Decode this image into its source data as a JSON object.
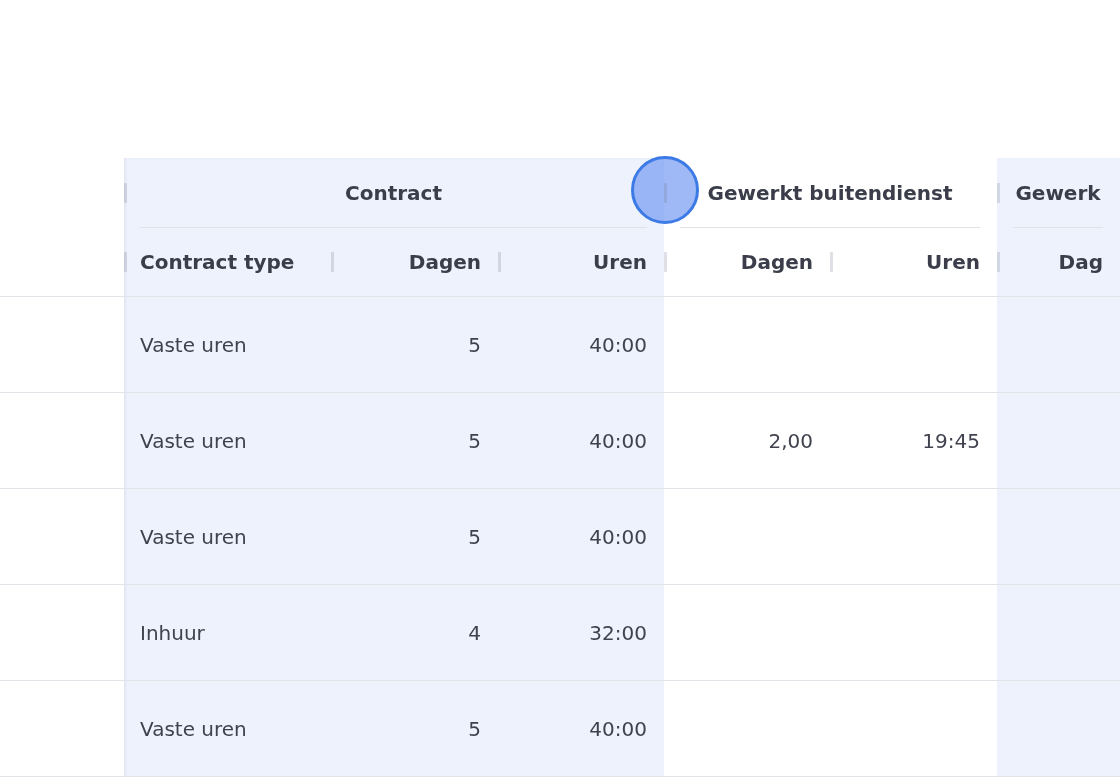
{
  "table": {
    "groups": [
      {
        "title": "Contract",
        "highlighted": true,
        "columns": [
          {
            "label": "Contract type",
            "kind": "text"
          },
          {
            "label": "Dagen",
            "kind": "number"
          },
          {
            "label": "Uren",
            "kind": "number"
          }
        ]
      },
      {
        "title": "Gewerkt buitendienst",
        "highlighted": false,
        "columns": [
          {
            "label": "Dagen",
            "kind": "number"
          },
          {
            "label": "Uren",
            "kind": "number"
          }
        ]
      },
      {
        "title": "Gewerk",
        "highlighted": true,
        "columns": [
          {
            "label": "Dag",
            "kind": "number"
          }
        ]
      }
    ],
    "rows": [
      {
        "cells": [
          "Vaste uren",
          "5",
          "40:00",
          null,
          null,
          null
        ]
      },
      {
        "cells": [
          "Vaste uren",
          "5",
          "40:00",
          "2,00",
          "19:45",
          null
        ]
      },
      {
        "cells": [
          "Vaste uren",
          "5",
          "40:00",
          null,
          null,
          null
        ]
      },
      {
        "cells": [
          "Inhuur",
          "4",
          "32:00",
          null,
          null,
          null
        ]
      },
      {
        "cells": [
          "Vaste uren",
          "5",
          "40:00",
          null,
          null,
          null
        ]
      }
    ]
  }
}
